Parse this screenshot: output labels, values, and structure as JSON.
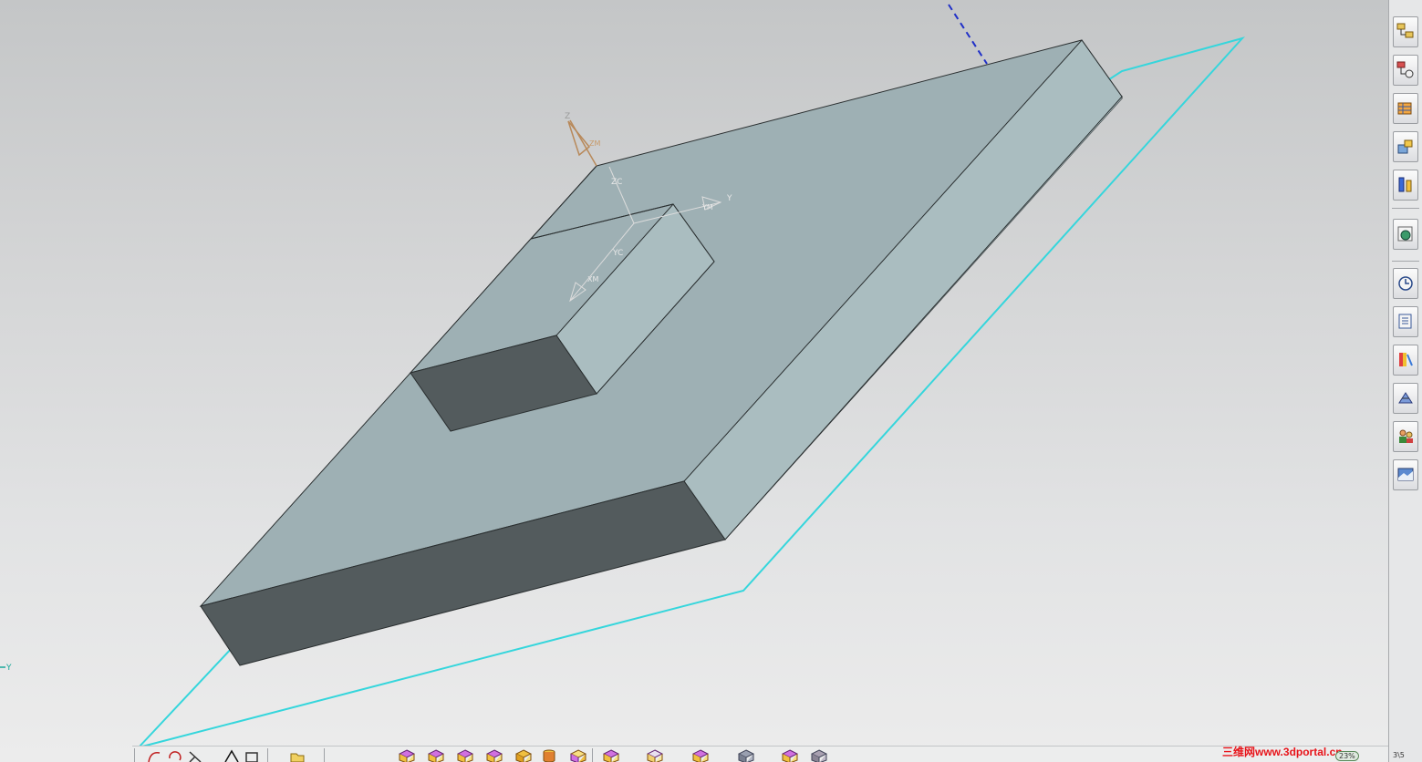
{
  "viewport": {
    "axis_labels": {
      "z": "Z",
      "zc": "ZC",
      "y": "Y",
      "yc": "YC",
      "xm": "XM",
      "ym": "YM",
      "zm": "ZM",
      "corner_y": "Y"
    },
    "colors": {
      "top_face": "#9eb0b4",
      "side_face": "#aabdc0",
      "dark_face": "#535b5d",
      "datum_plane": "#35d6dc",
      "axis_orange": "#b8895a",
      "axis_gray": "#dcdcdc"
    }
  },
  "right_toolbar": {
    "items": [
      {
        "icon": "assembly-navigator-icon"
      },
      {
        "icon": "constraint-navigator-icon"
      },
      {
        "icon": "part-navigator-icon"
      },
      {
        "icon": "reuse-library-icon"
      },
      {
        "icon": "hd3d-tools-icon"
      },
      {
        "icon": "web-browser-icon"
      },
      {
        "icon": "history-icon"
      },
      {
        "icon": "system-materials-icon"
      },
      {
        "icon": "roles-palette-icon"
      },
      {
        "icon": "process-studio-icon"
      },
      {
        "icon": "user-roles-icon"
      },
      {
        "icon": "system-scenes-icon"
      }
    ]
  },
  "bottom_toolbar": {
    "zoom": "23%",
    "corner": "3\\5"
  },
  "watermark": {
    "text": "三维网www.3dportal.cn"
  }
}
